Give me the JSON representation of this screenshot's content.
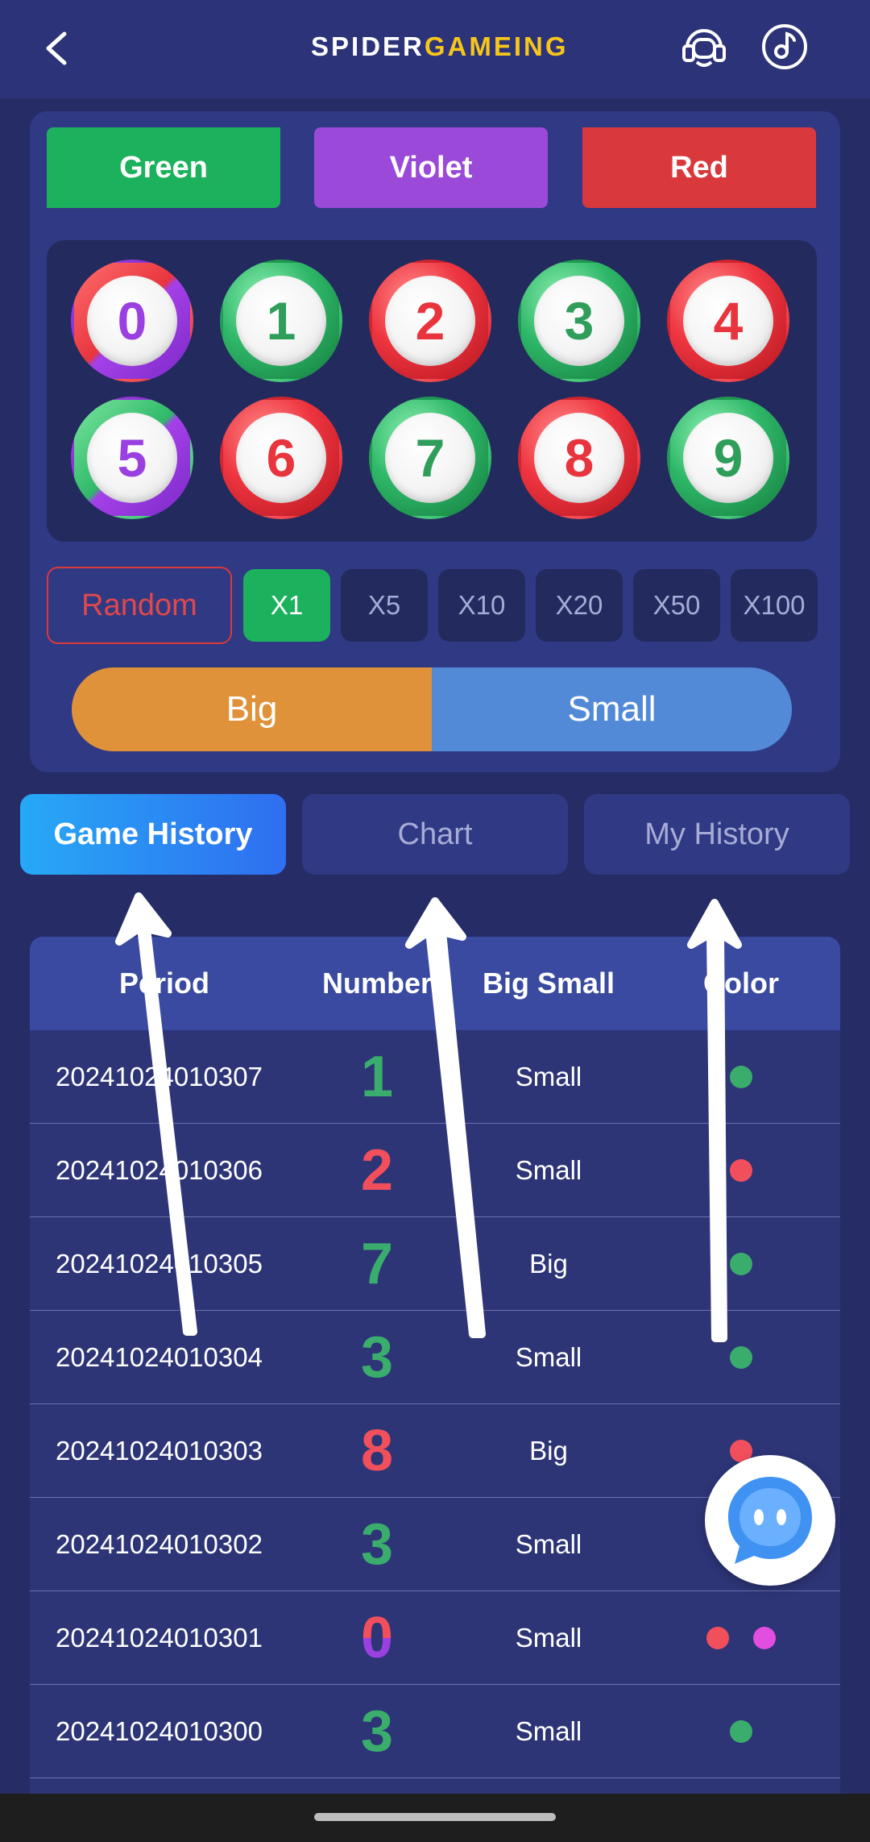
{
  "header": {
    "logo_part1": "SPIDER",
    "logo_part2": "GAMEING",
    "icons": [
      "back-icon",
      "headset-icon",
      "music-icon"
    ]
  },
  "colors_bet": {
    "green": "Green",
    "violet": "Violet",
    "red": "Red"
  },
  "numbers": [
    {
      "n": "0",
      "color": "red-violet"
    },
    {
      "n": "1",
      "color": "green"
    },
    {
      "n": "2",
      "color": "red"
    },
    {
      "n": "3",
      "color": "green"
    },
    {
      "n": "4",
      "color": "red"
    },
    {
      "n": "5",
      "color": "green-violet"
    },
    {
      "n": "6",
      "color": "red"
    },
    {
      "n": "7",
      "color": "green"
    },
    {
      "n": "8",
      "color": "red"
    },
    {
      "n": "9",
      "color": "green"
    }
  ],
  "multipliers": {
    "random": "Random",
    "options": [
      "X1",
      "X5",
      "X10",
      "X20",
      "X50",
      "X100"
    ],
    "selected": "X1"
  },
  "big_small": {
    "big": "Big",
    "small": "Small"
  },
  "tabs": {
    "game_history": "Game History",
    "chart": "Chart",
    "my_history": "My History",
    "active": "Game History"
  },
  "table": {
    "headers": {
      "period": "Period",
      "number": "Number",
      "big_small": "Big Small",
      "color": "Color"
    },
    "rows": [
      {
        "period": "20241024010307",
        "number": "1",
        "big_small": "Small",
        "colors": [
          "green"
        ]
      },
      {
        "period": "20241024010306",
        "number": "2",
        "big_small": "Small",
        "colors": [
          "red"
        ]
      },
      {
        "period": "20241024010305",
        "number": "7",
        "big_small": "Big",
        "colors": [
          "green"
        ]
      },
      {
        "period": "20241024010304",
        "number": "3",
        "big_small": "Small",
        "colors": [
          "green"
        ]
      },
      {
        "period": "20241024010303",
        "number": "8",
        "big_small": "Big",
        "colors": [
          "red"
        ]
      },
      {
        "period": "20241024010302",
        "number": "3",
        "big_small": "Small",
        "colors": [
          "green"
        ]
      },
      {
        "period": "20241024010301",
        "number": "0",
        "big_small": "Small",
        "colors": [
          "red",
          "violet"
        ]
      },
      {
        "period": "20241024010300",
        "number": "3",
        "big_small": "Small",
        "colors": [
          "green"
        ]
      }
    ]
  },
  "palette": {
    "green": "#1cb15c",
    "violet": "#9a49d8",
    "red": "#d9393d",
    "big": "#df9239",
    "small": "#528ad8",
    "background": "#262c66"
  }
}
